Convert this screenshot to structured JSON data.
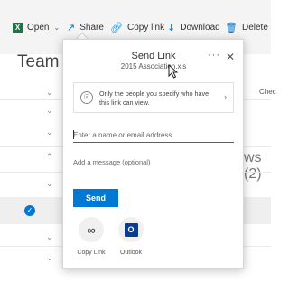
{
  "toolbar": {
    "open_label": "Open",
    "share_label": "Share",
    "copy_link_label": "Copy link",
    "download_label": "Download",
    "delete_label": "Delete"
  },
  "background": {
    "page_title": "Team D",
    "column_header": "Chec",
    "partial_text": "ws (2)"
  },
  "dialog": {
    "title": "Send Link",
    "subtitle": "2015 Association.xls",
    "more_label": "···",
    "close_label": "✕",
    "permission_text": "Only the people you specify who have this link can view.",
    "name_input": {
      "value": "",
      "placeholder": "Enter a name or email address"
    },
    "message_input": {
      "value": "",
      "placeholder": "Add a message (optional)"
    },
    "send_label": "Send",
    "share_options": [
      {
        "label": "Copy Link",
        "icon": "link-icon"
      },
      {
        "label": "Outlook",
        "icon": "outlook-icon"
      }
    ]
  },
  "colors": {
    "accent": "#0078d4",
    "excel": "#217346",
    "outlook": "#0a3d91"
  }
}
